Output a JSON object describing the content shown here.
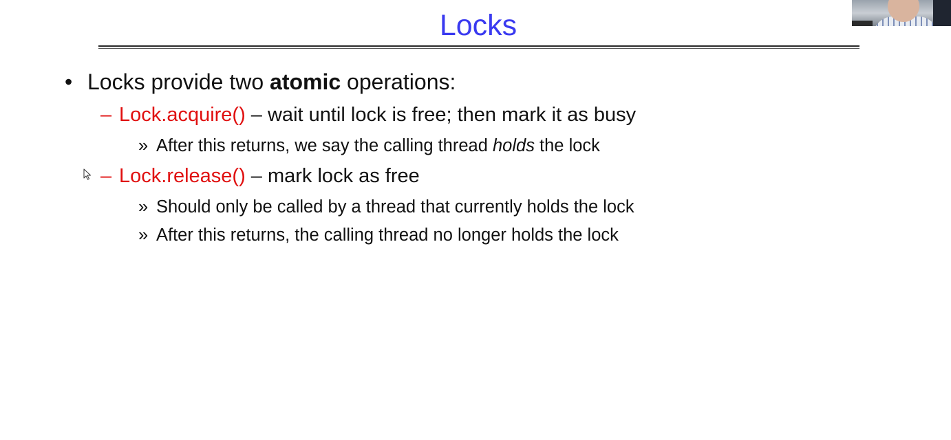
{
  "slide": {
    "title": "Locks",
    "bullet_1": {
      "marker": "•",
      "pre": "Locks provide two ",
      "bold": "atomic",
      "post": " operations:"
    },
    "sub_1": {
      "dash": "–",
      "name": "Lock.acquire()",
      "desc": " – wait until lock is free; then mark it as busy",
      "details": [
        {
          "marker": "»",
          "pre": "After this returns, we say the calling thread ",
          "ital": "holds",
          "post": " the lock"
        }
      ]
    },
    "sub_2": {
      "dash": "–",
      "name": "Lock.release()",
      "desc": " – mark lock as free",
      "details": [
        {
          "marker": "»",
          "text": "Should only be called by a thread that currently holds the lock"
        },
        {
          "marker": "»",
          "text": "After this returns, the calling thread no longer holds the lock"
        }
      ]
    }
  },
  "icons": {
    "cursor": "mouse-pointer-icon",
    "webcam": "presenter-video"
  },
  "colors": {
    "title": "#3a3af0",
    "function_name": "#e01010",
    "body_text": "#111111",
    "background": "#ffffff"
  }
}
